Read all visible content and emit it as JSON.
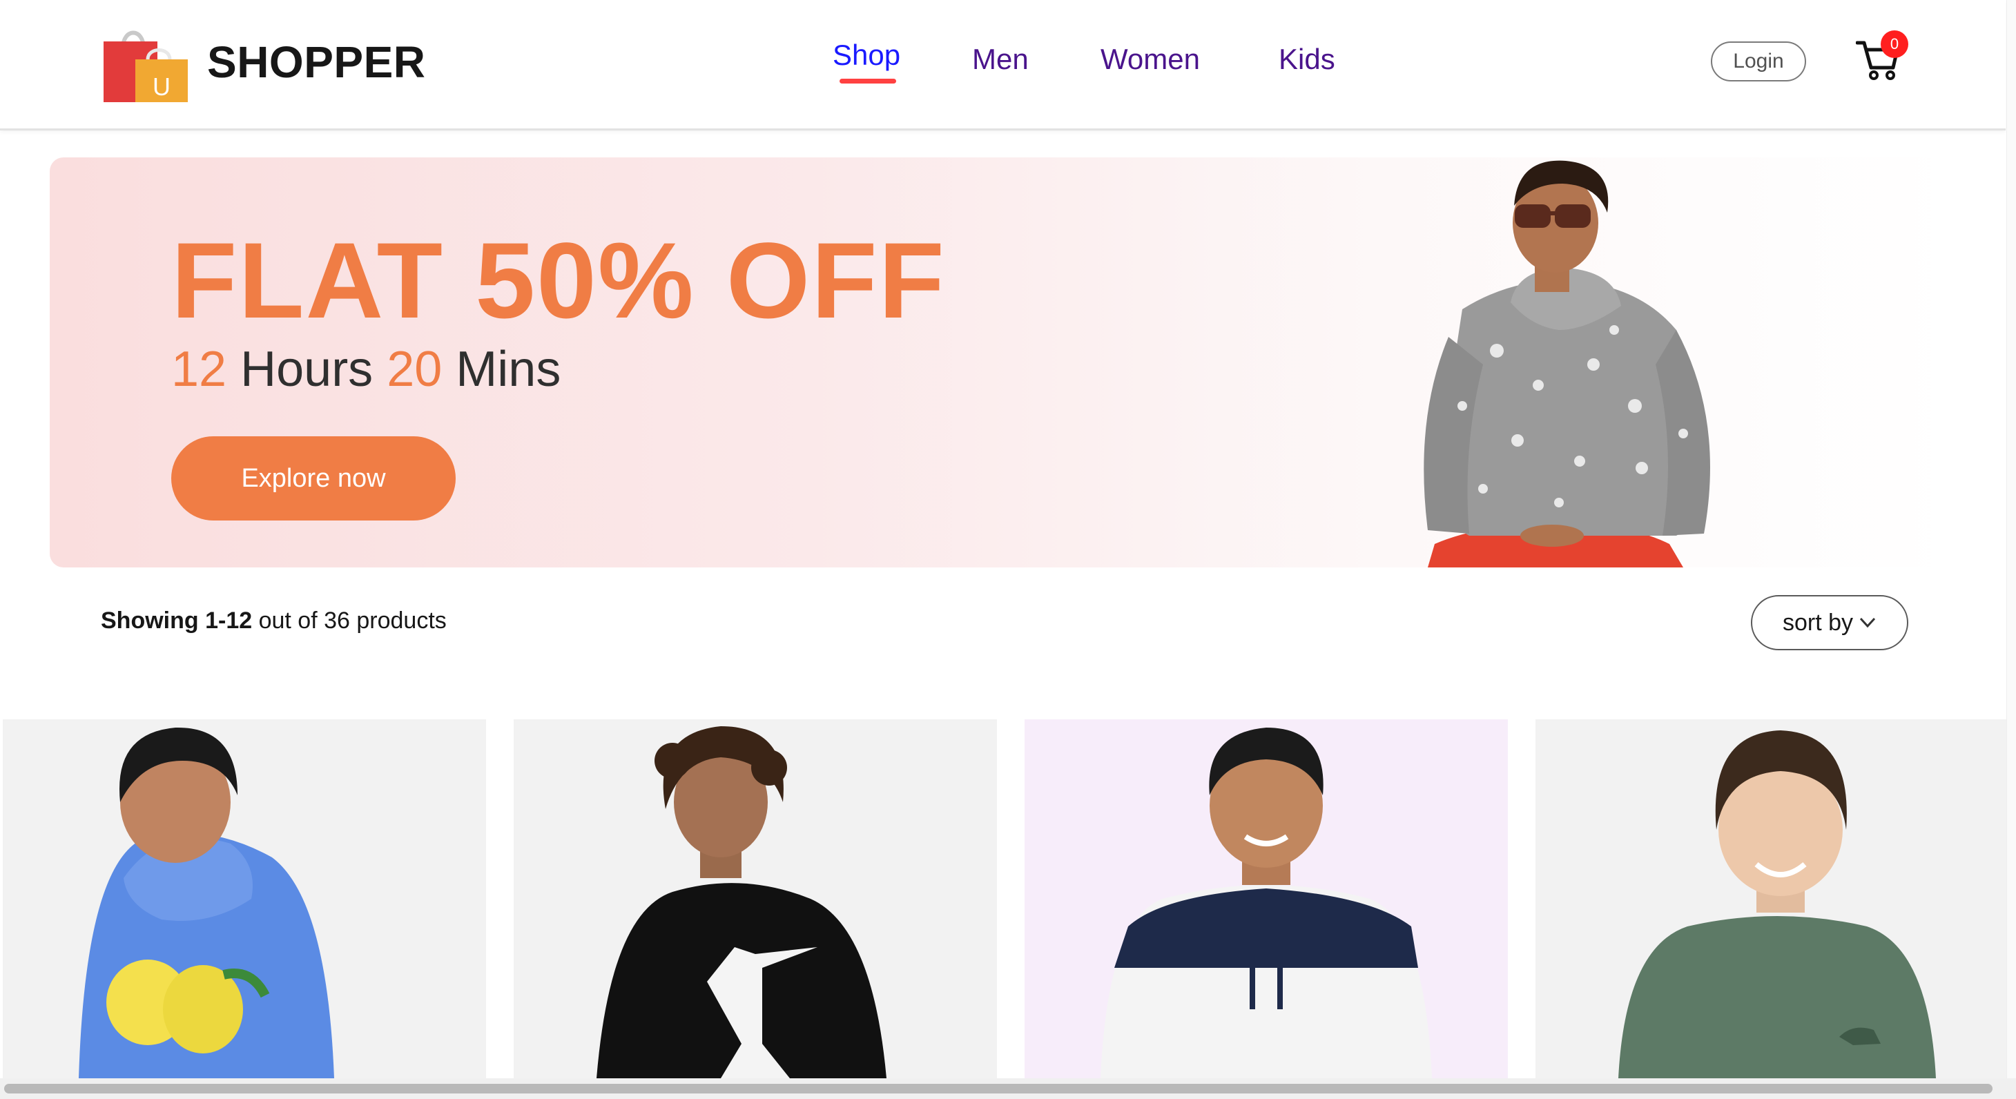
{
  "brand": {
    "name": "SHOPPER",
    "logo_letter": "U"
  },
  "nav": {
    "items": [
      {
        "label": "Shop",
        "active": true
      },
      {
        "label": "Men",
        "active": false
      },
      {
        "label": "Women",
        "active": false
      },
      {
        "label": "Kids",
        "active": false
      }
    ]
  },
  "header": {
    "login_label": "Login",
    "cart_count": "0"
  },
  "hero": {
    "headline": "FLAT 50% OFF",
    "hours_value": "12",
    "hours_label": "Hours",
    "mins_value": "20",
    "mins_label": "Mins",
    "cta_label": "Explore now"
  },
  "results": {
    "range_text": "Showing 1-12",
    "total_text": "out of 36 products"
  },
  "sort": {
    "label": "sort by"
  },
  "products": [
    {
      "name": "blue-lemon-hoodie",
      "background": "#f2f2f2"
    },
    {
      "name": "black-graphic-hoodie",
      "background": "#f2f2f2"
    },
    {
      "name": "colorblock-hoodie",
      "background": "#f7edfa"
    },
    {
      "name": "green-dino-sweatshirt",
      "background": "#f2f2f2"
    }
  ],
  "colors": {
    "accent": "#f07d45",
    "nav_text": "#4a148c",
    "nav_active": "#1a1aff",
    "underline": "#ff4141",
    "badge": "#ff1f1f"
  }
}
